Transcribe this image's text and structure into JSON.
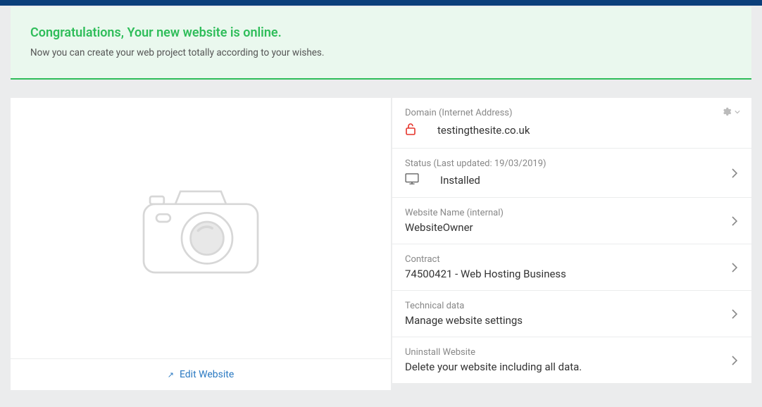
{
  "banner": {
    "title": "Congratulations, Your new website is online.",
    "subtitle": "Now you can create your web project totally according to your wishes."
  },
  "left": {
    "edit_link": "Edit Website"
  },
  "panels": {
    "domain": {
      "label": "Domain (Internet Address)",
      "value": "testingthesite.co.uk"
    },
    "status": {
      "label": "Status  (Last updated: 19/03/2019)",
      "value": "Installed"
    },
    "website_name": {
      "label": "Website Name (internal)",
      "value": "WebsiteOwner"
    },
    "contract": {
      "label": "Contract",
      "value": "74500421 - Web Hosting Business"
    },
    "technical": {
      "label": "Technical data",
      "value": "Manage website settings"
    },
    "uninstall": {
      "label": "Uninstall Website",
      "value": "Delete your website including all data."
    }
  }
}
